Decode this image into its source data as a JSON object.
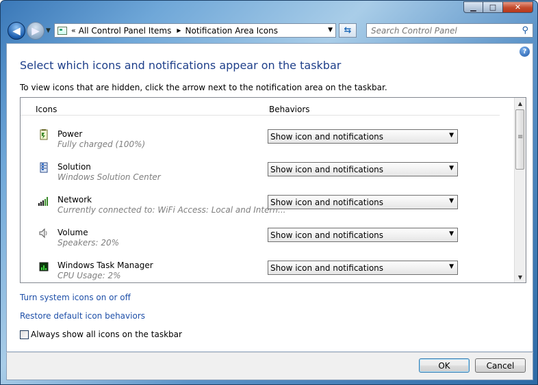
{
  "window": {
    "min_icon": "minimize-icon",
    "max_icon": "maximize-icon",
    "close_icon": "close-icon"
  },
  "nav": {
    "back_icon": "back-arrow-icon",
    "forward_icon": "forward-arrow-icon",
    "history_icon": "chevron-down-icon"
  },
  "address": {
    "chevron": "«",
    "crumbs": [
      "All Control Panel Items",
      "Notification Area Icons"
    ],
    "crumb_separator": "▶"
  },
  "search": {
    "placeholder": "Search Control Panel"
  },
  "page": {
    "title": "Select which icons and notifications appear on the taskbar",
    "description": "To view icons that are hidden, click the arrow next to the notification area on the taskbar."
  },
  "list": {
    "col_icons": "Icons",
    "col_behaviors": "Behaviors",
    "rows": [
      {
        "name": "Power",
        "status": "Fully charged (100%)",
        "behavior": "Show icon and notifications",
        "icon": "battery-icon"
      },
      {
        "name": "Solution",
        "status": "Windows Solution Center",
        "behavior": "Show icon and notifications",
        "icon": "server-icon"
      },
      {
        "name": "Network",
        "status": "Currently connected to: WiFi Access:  Local and Intern...",
        "behavior": "Show icon and notifications",
        "icon": "signal-bars-icon"
      },
      {
        "name": "Volume",
        "status": "Speakers: 20%",
        "behavior": "Show icon and notifications",
        "icon": "speaker-icon"
      },
      {
        "name": "Windows Task Manager",
        "status": "CPU Usage: 2%",
        "behavior": "Show icon and notifications",
        "icon": "cpu-monitor-icon"
      }
    ],
    "scroll_fraction": 0.0
  },
  "links": {
    "system_icons": "Turn system icons on or off",
    "restore": "Restore default icon behaviors"
  },
  "always_show": {
    "label": "Always show all icons on the taskbar",
    "checked": false
  },
  "buttons": {
    "ok": "OK",
    "cancel": "Cancel"
  },
  "colors": {
    "title": "#1e3f8a",
    "link": "#1e4fa8",
    "status_text": "#7e7e7e"
  }
}
